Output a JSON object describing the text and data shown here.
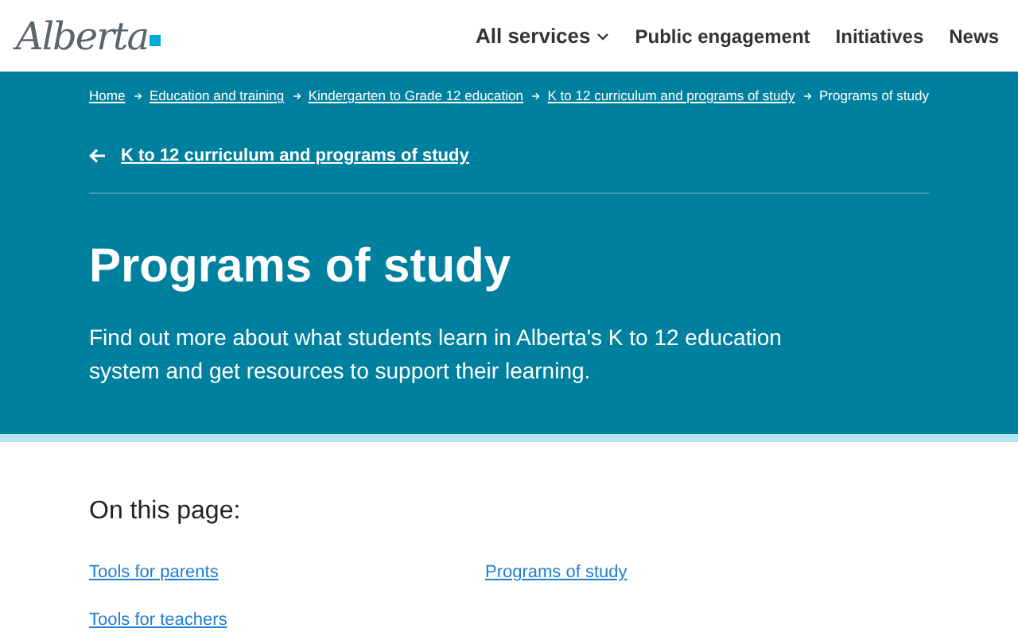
{
  "header": {
    "logo": "Alberta",
    "nav": [
      {
        "label": "All services",
        "kind": "dropdown"
      },
      {
        "label": "Public engagement",
        "kind": "link"
      },
      {
        "label": "Initiatives",
        "kind": "link"
      },
      {
        "label": "News",
        "kind": "link"
      }
    ]
  },
  "breadcrumb": [
    {
      "label": "Home",
      "current": false
    },
    {
      "label": "Education and training",
      "current": false
    },
    {
      "label": "Kindergarten to Grade 12 education",
      "current": false
    },
    {
      "label": "K to 12 curriculum and programs of study",
      "current": false
    },
    {
      "label": "Programs of study",
      "current": true
    }
  ],
  "back_link": "K to 12 curriculum and programs of study",
  "title": "Programs of study",
  "description": "Find out more about what students learn in Alberta's K to 12 education system and get resources to support their learning.",
  "on_this_page": {
    "heading": "On this page:",
    "links": [
      "Tools for parents",
      "Programs of study",
      "Tools for teachers"
    ]
  }
}
